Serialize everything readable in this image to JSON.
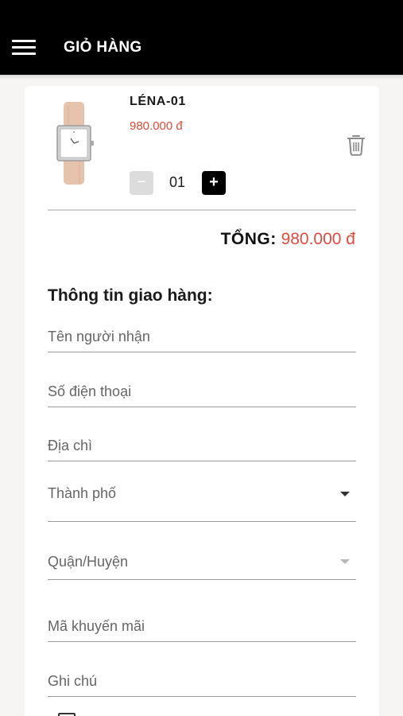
{
  "header": {
    "title": "GIỎ HÀNG",
    "menu_icon": "menu-icon"
  },
  "cart": {
    "items": [
      {
        "name": "LÉNA-01",
        "price": "980.000 đ",
        "quantity": "01",
        "minus_label": "−",
        "plus_label": "+",
        "image_icon": "wristwatch-image",
        "delete_icon": "trash-icon"
      }
    ],
    "total_label": "TỔNG:",
    "total_value": "980.000 đ"
  },
  "shipping": {
    "title": "Thông tin giao hàng:",
    "recipient_placeholder": "Tên người nhận",
    "phone_placeholder": "Số điện thoại",
    "address_placeholder": "Địa chì",
    "city_label": "Thành phố",
    "district_label": "Quận/Huyện",
    "promo_placeholder": "Mã khuyến mãi",
    "note_placeholder": "Ghi chú"
  },
  "colors": {
    "appbar": "#000000",
    "price": "#e14b3b",
    "plus_button": "#000000",
    "minus_button": "#dcdcdc"
  }
}
